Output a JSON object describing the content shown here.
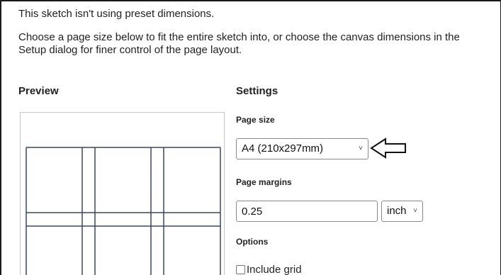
{
  "message": {
    "line1": "This sketch isn't using preset dimensions.",
    "line2": "Choose a page size below to fit the entire sketch into, or choose the canvas dimensions in the Setup dialog for finer control of the page layout."
  },
  "preview": {
    "title": "Preview"
  },
  "settings": {
    "title": "Settings",
    "page_size": {
      "label": "Page size",
      "selected": "A4 (210x297mm)"
    },
    "page_margins": {
      "label": "Page margins",
      "value": "0.25",
      "unit": "inch"
    },
    "options": {
      "label": "Options",
      "include_grid_label": "Include grid",
      "include_grid_checked": false
    }
  },
  "icons": {
    "dropdown": "chevron-down-icon",
    "pointer": "arrow-left-outline-icon"
  },
  "colors": {
    "preview_lines": "#3a4660",
    "text": "#222222"
  }
}
